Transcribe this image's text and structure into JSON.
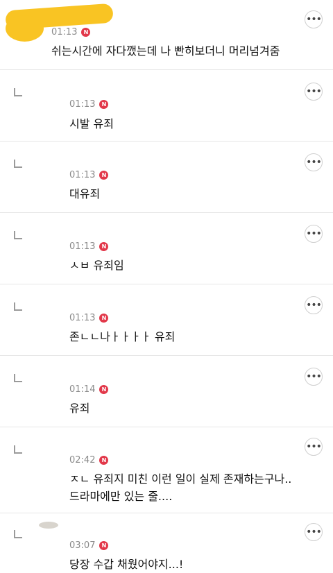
{
  "colors": {
    "new_badge": "#e2384a",
    "divider": "#e6e6e6",
    "redaction": "#f9c423"
  },
  "badge_text": "N",
  "more_icon": "•••",
  "comments": [
    {
      "time": "01:13",
      "text": "쉬는시간에 자다깼는데 나 빤히보더니 머리넘겨줌"
    },
    {
      "time": "01:13",
      "text": "시발 유죄"
    },
    {
      "time": "01:13",
      "text": "대유죄"
    },
    {
      "time": "01:13",
      "text": "ㅅㅂ 유죄임"
    },
    {
      "time": "01:13",
      "text": "존ㄴㄴ나ㅏㅏㅏㅏ 유죄"
    },
    {
      "time": "01:14",
      "text": "유죄"
    },
    {
      "time": "02:42",
      "text": "ㅈㄴ 유죄지 미친 이런 일이 실제 존재하는구나..\n드라마에만 있는 줄...."
    },
    {
      "time": "03:07",
      "text": "당장 수갑 채웠어야지...!"
    }
  ]
}
